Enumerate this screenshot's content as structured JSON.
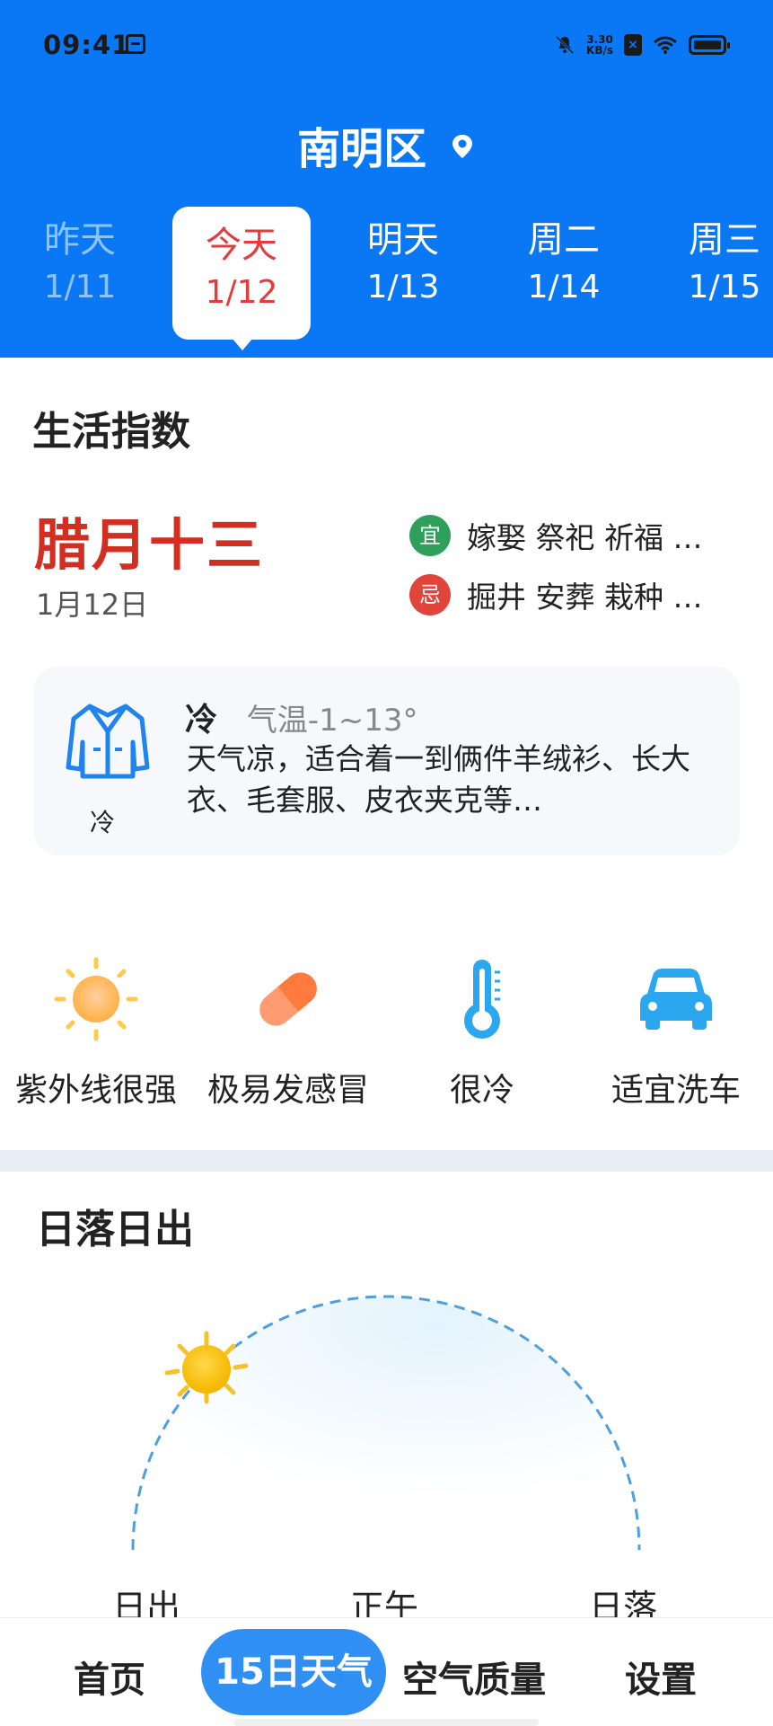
{
  "status_bar": {
    "time": "09:41",
    "net_speed_top": "3.30",
    "net_speed_bottom": "KB/s"
  },
  "header": {
    "location": "南明区",
    "days": [
      {
        "name": "昨天",
        "date": "1/11",
        "state": "past"
      },
      {
        "name": "今天",
        "date": "1/12",
        "state": "selected"
      },
      {
        "name": "明天",
        "date": "1/13",
        "state": "future"
      },
      {
        "name": "周二",
        "date": "1/14",
        "state": "future"
      },
      {
        "name": "周三",
        "date": "1/15",
        "state": "future"
      }
    ]
  },
  "life_index": {
    "title": "生活指数",
    "lunar_date": "腊月十三",
    "gregorian_date": "1月12日",
    "yi": {
      "badge": "宜",
      "text": "嫁娶 祭祀 祈福 …"
    },
    "ji": {
      "badge": "忌",
      "text": "掘井 安葬 栽种 …"
    },
    "dressing": {
      "icon_label": "冷",
      "level": "冷",
      "temperature": "气温-1~13°",
      "description": "天气凉，适合着一到俩件羊绒衫、长大衣、毛套服、皮衣夹克等…"
    },
    "items": [
      {
        "label": "紫外线很强",
        "icon": "sun-icon"
      },
      {
        "label": "极易发感冒",
        "icon": "pill-icon"
      },
      {
        "label": "很冷",
        "icon": "thermometer-icon"
      },
      {
        "label": "适宜洗车",
        "icon": "car-icon"
      }
    ]
  },
  "sun": {
    "title": "日落日出",
    "labels": {
      "sunrise": "日出",
      "noon": "正午",
      "sunset": "日落"
    }
  },
  "nav": {
    "home": "首页",
    "forecast15": "15日天气",
    "air": "空气质量",
    "settings": "设置"
  },
  "colors": {
    "header_blue": "#0a78f5",
    "today_red": "#e23c3c",
    "lunar_red": "#d22f22",
    "nav_active": "#2f8ff2"
  }
}
